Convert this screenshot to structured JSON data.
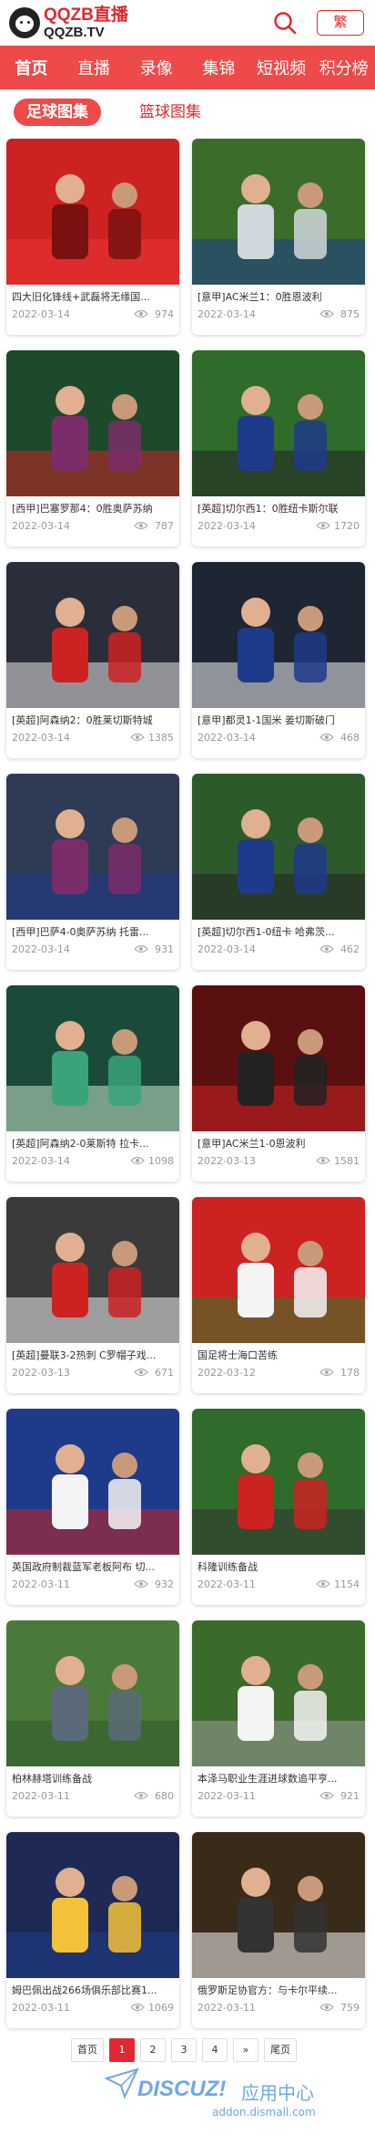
{
  "header": {
    "logo_top": "QQZB直播",
    "logo_bottom": "QQZB.TV",
    "menu_label": "繁"
  },
  "nav": [
    "首页",
    "直播",
    "录像",
    "集锦",
    "短视频",
    "积分榜"
  ],
  "subnav": [
    "足球图集",
    "篮球图集"
  ],
  "cards": [
    {
      "title": "四大旧化锋线+武磊将无缘国...",
      "date": "2022-03-14",
      "views": "974"
    },
    {
      "title": "[意甲]AC米兰1：0胜恩波利",
      "date": "2022-03-14",
      "views": "875"
    },
    {
      "title": "[西甲]巴塞罗那4：0胜奥萨苏纳",
      "date": "2022-03-14",
      "views": "787"
    },
    {
      "title": "[英超]切尔西1：0胜纽卡斯尔联",
      "date": "2022-03-14",
      "views": "1720"
    },
    {
      "title": "[英超]阿森纳2：0胜莱切斯特城",
      "date": "2022-03-14",
      "views": "1385"
    },
    {
      "title": "[意甲]都灵1-1国米 姜切斯破门",
      "date": "2022-03-14",
      "views": "468"
    },
    {
      "title": "[西甲]巴萨4-0奥萨苏纳 托雷...",
      "date": "2022-03-14",
      "views": "931"
    },
    {
      "title": "[英超]切尔西1-0纽卡 哈弗茨...",
      "date": "2022-03-14",
      "views": "462"
    },
    {
      "title": "[英超]阿森纳2-0莱斯特 拉卡...",
      "date": "2022-03-14",
      "views": "1098"
    },
    {
      "title": "[意甲]AC米兰1-0恩波利",
      "date": "2022-03-13",
      "views": "1581"
    },
    {
      "title": "[英超]曼联3-2热刺 C罗帽子戏...",
      "date": "2022-03-13",
      "views": "671"
    },
    {
      "title": "国足将士海口苦练",
      "date": "2022-03-12",
      "views": "178"
    },
    {
      "title": "英国政府制裁蓝军老板阿布 切...",
      "date": "2022-03-11",
      "views": "932"
    },
    {
      "title": "科隆训练备战",
      "date": "2022-03-11",
      "views": "1154"
    },
    {
      "title": "柏林赫塔训练备战",
      "date": "2022-03-11",
      "views": "680"
    },
    {
      "title": "本泽马职业生涯进球数追平亨...",
      "date": "2022-03-11",
      "views": "921"
    },
    {
      "title": "姆巴佩出战266场俱乐部比赛1...",
      "date": "2022-03-11",
      "views": "1069"
    },
    {
      "title": "俄罗斯足协官方：与卡尔平续...",
      "date": "2022-03-11",
      "views": "759"
    }
  ],
  "pagination": [
    "首页",
    "1",
    "2",
    "3",
    "4",
    "»",
    "尾页"
  ],
  "footer": {
    "brand": "DISCUZ!",
    "center": "应用中心",
    "domain": "addon.dismall.com"
  },
  "colors": {
    "accent": "#e1282e",
    "nav_bg": "#ee4a4a"
  }
}
